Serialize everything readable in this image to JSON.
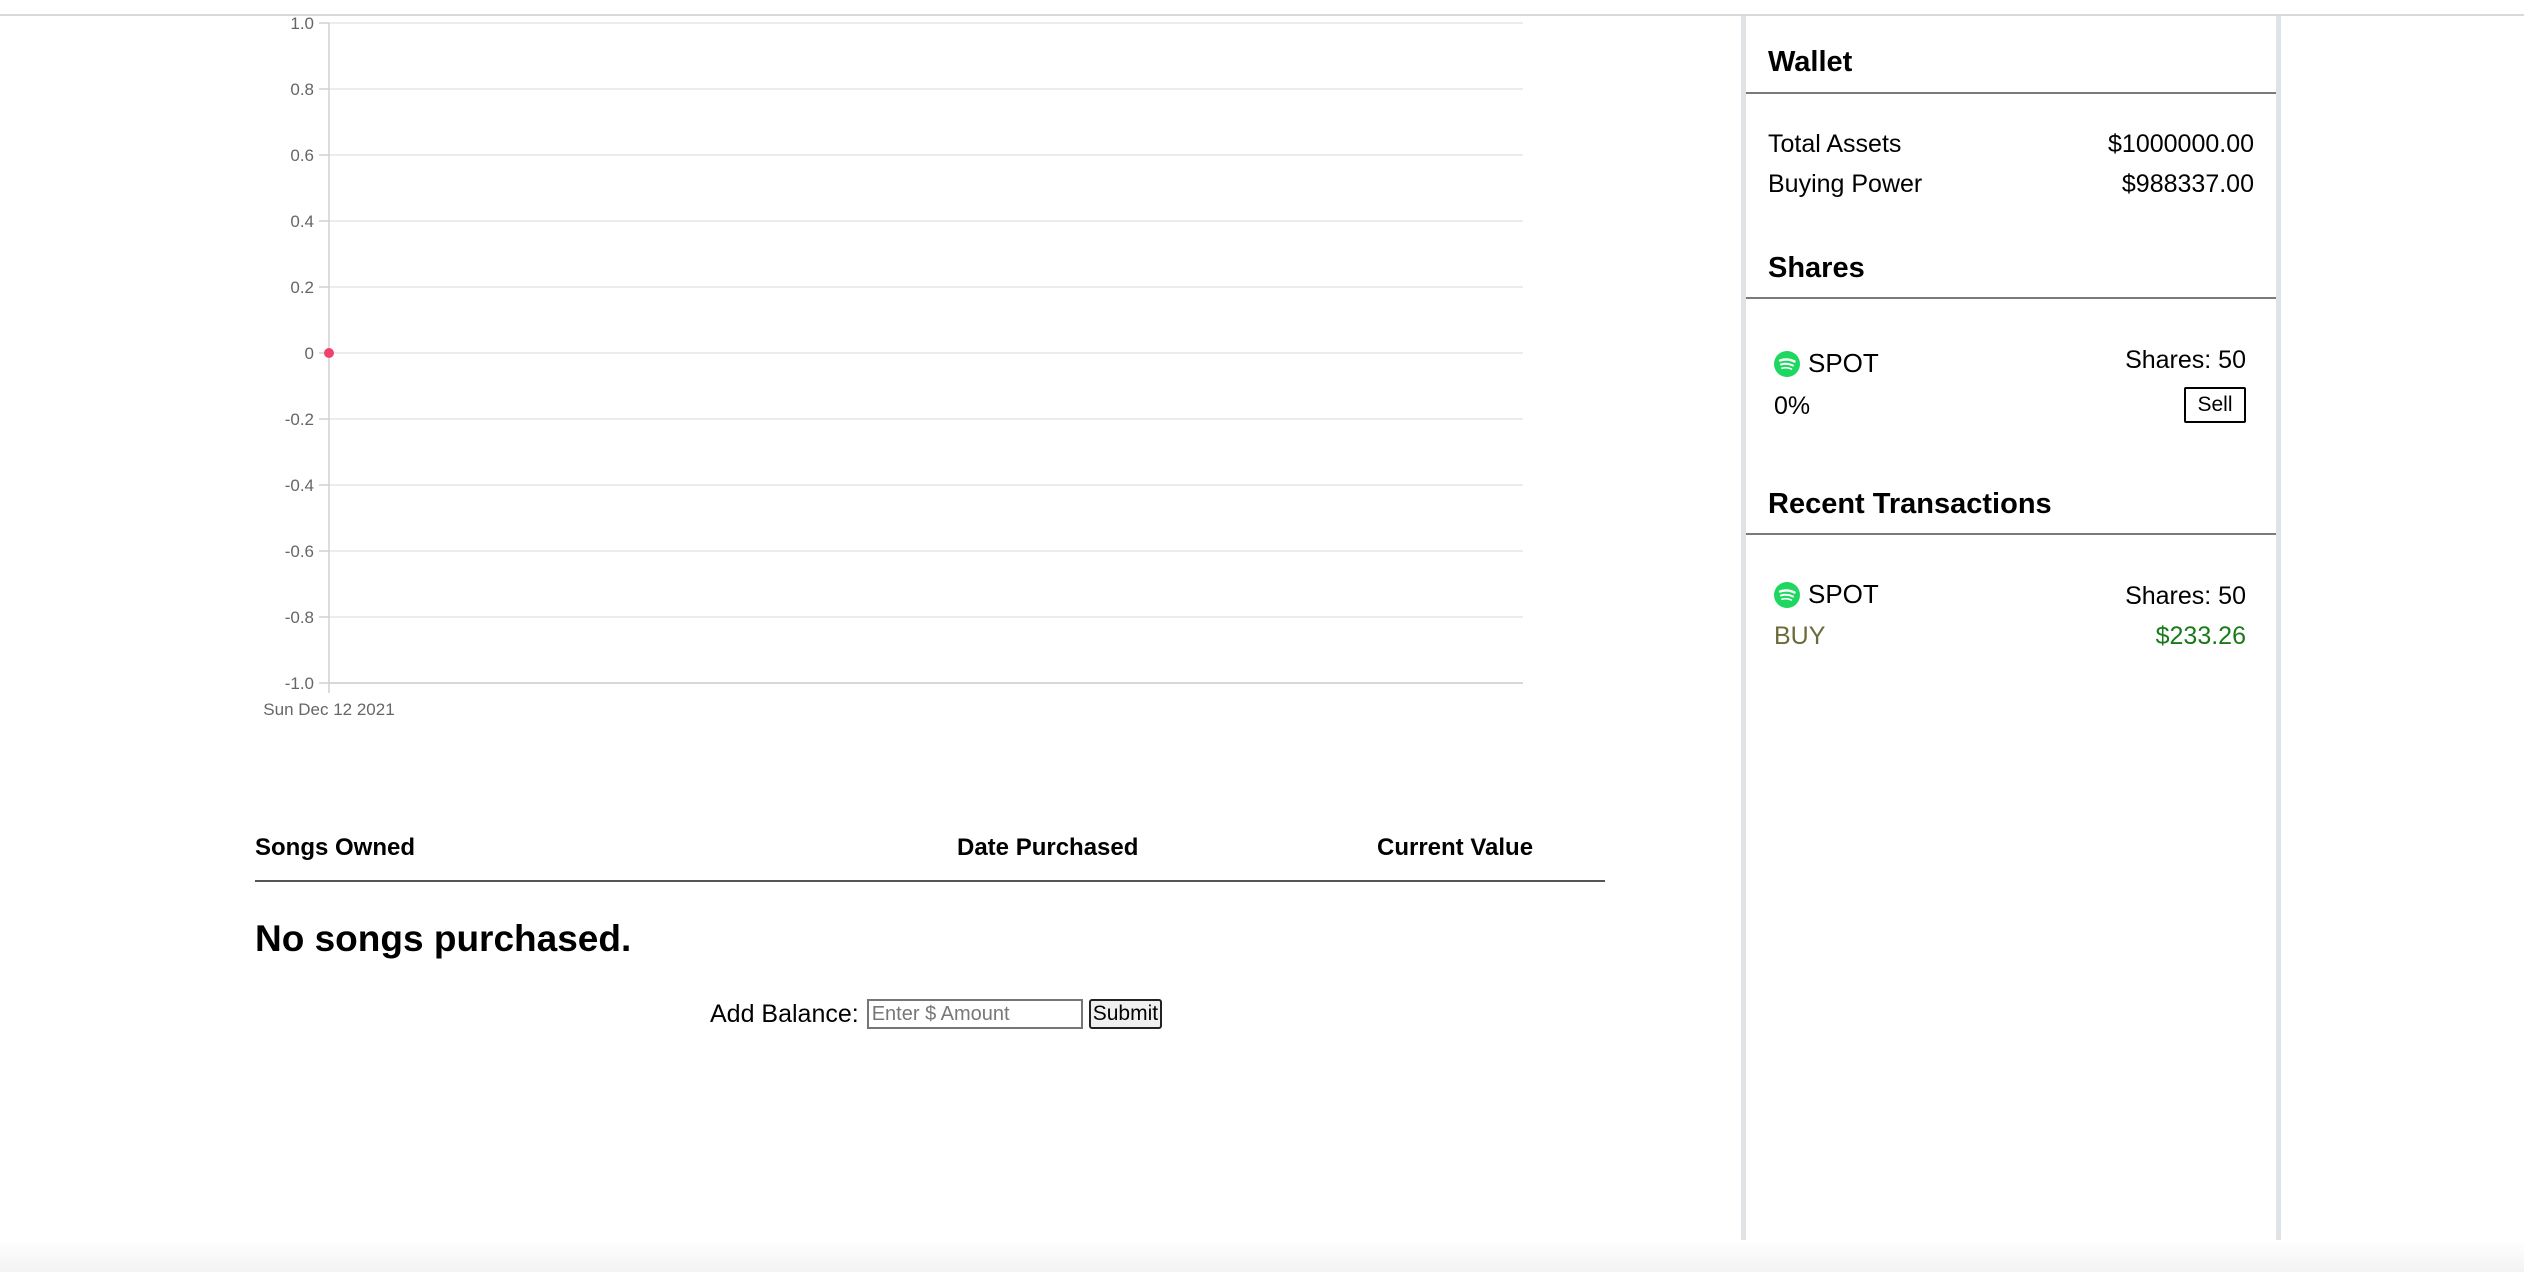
{
  "chart_data": {
    "type": "line",
    "x": [
      "Sun Dec 12 2021"
    ],
    "series": [
      {
        "values": [
          0
        ]
      }
    ],
    "ylim": [
      -1.0,
      1.0
    ],
    "yticks": [
      "1.0",
      "0.8",
      "0.6",
      "0.4",
      "0.2",
      "0",
      "-0.2",
      "-0.4",
      "-0.6",
      "-0.8",
      "-1.0"
    ],
    "xtick_labels": [
      "Sun Dec 12 2021"
    ],
    "grid": true,
    "point_color": "#f0436b"
  },
  "songs_table": {
    "headers": [
      "Songs Owned",
      "Date Purchased",
      "Current Value"
    ],
    "empty_message": "No songs purchased."
  },
  "add_balance": {
    "label": "Add Balance:",
    "placeholder": "Enter $ Amount",
    "submit_label": "Submit"
  },
  "wallet": {
    "title": "Wallet",
    "rows": [
      {
        "label": "Total Assets",
        "value": "$1000000.00"
      },
      {
        "label": "Buying Power",
        "value": "$988337.00"
      }
    ]
  },
  "shares": {
    "title": "Shares",
    "items": [
      {
        "icon": "spotify-icon",
        "ticker": "SPOT",
        "shares": "Shares: 50",
        "change": "0%",
        "sell_label": "Sell"
      }
    ]
  },
  "transactions": {
    "title": "Recent Transactions",
    "items": [
      {
        "icon": "spotify-icon",
        "ticker": "SPOT",
        "shares": "Shares: 50",
        "type": "BUY",
        "amount": "$233.26"
      }
    ]
  },
  "colors": {
    "spotify_green": "#1ed760",
    "buy_label": "#6b6b3a",
    "amount_green": "#1a7a1a",
    "point": "#f0436b"
  }
}
